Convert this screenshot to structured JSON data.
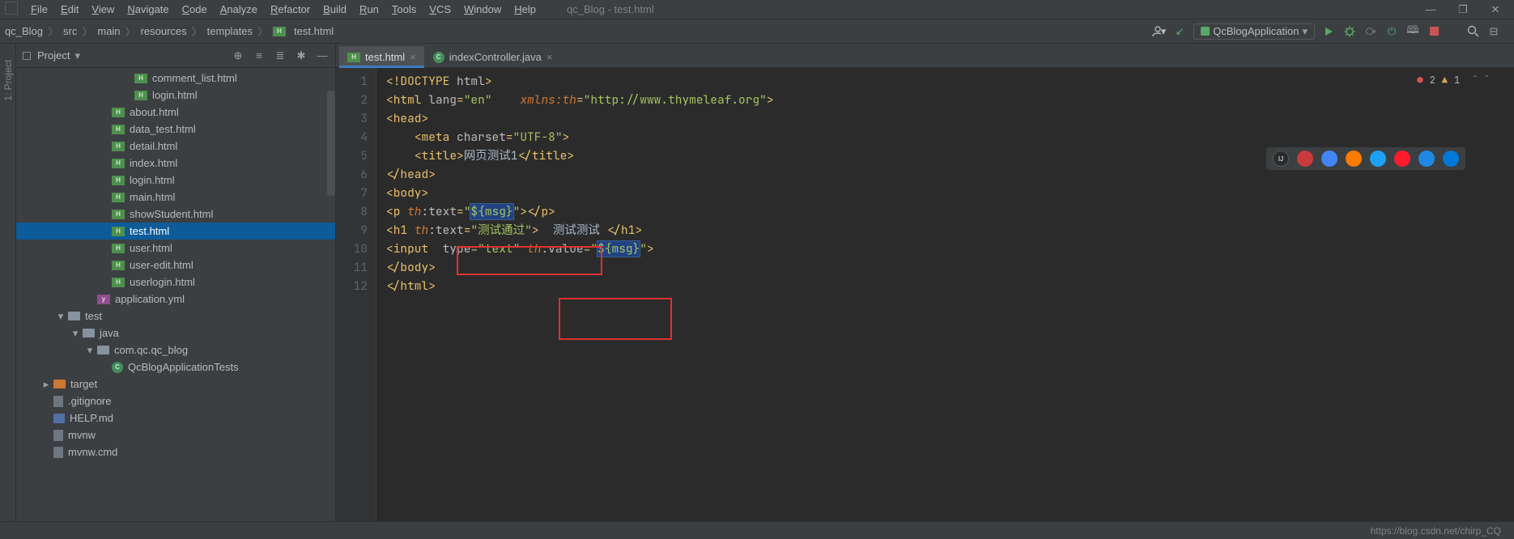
{
  "menus": [
    "File",
    "Edit",
    "View",
    "Navigate",
    "Code",
    "Analyze",
    "Refactor",
    "Build",
    "Run",
    "Tools",
    "VCS",
    "Window",
    "Help"
  ],
  "windowTitle": "qc_Blog - test.html",
  "breadcrumbs": [
    "qc_Blog",
    "src",
    "main",
    "resources",
    "templates",
    "test.html"
  ],
  "runConfig": "QcBlogApplication",
  "sidebar": {
    "title": "Project",
    "vertical": "1: Project",
    "items": [
      {
        "indent": 5,
        "icon": "html",
        "label": "comment_list.html"
      },
      {
        "indent": 5,
        "icon": "html",
        "label": "login.html"
      },
      {
        "indent": 4,
        "icon": "html",
        "label": "about.html"
      },
      {
        "indent": 4,
        "icon": "html",
        "label": "data_test.html"
      },
      {
        "indent": 4,
        "icon": "html",
        "label": "detail.html"
      },
      {
        "indent": 4,
        "icon": "html",
        "label": "index.html"
      },
      {
        "indent": 4,
        "icon": "html",
        "label": "login.html"
      },
      {
        "indent": 4,
        "icon": "html",
        "label": "main.html"
      },
      {
        "indent": 4,
        "icon": "html",
        "label": "showStudent.html"
      },
      {
        "indent": 4,
        "icon": "html",
        "label": "test.html",
        "selected": true
      },
      {
        "indent": 4,
        "icon": "html",
        "label": "user.html"
      },
      {
        "indent": 4,
        "icon": "html",
        "label": "user-edit.html"
      },
      {
        "indent": 4,
        "icon": "html",
        "label": "userlogin.html"
      },
      {
        "indent": 3,
        "icon": "yml",
        "label": "application.yml"
      },
      {
        "indent": 1,
        "icon": "folder",
        "label": "test",
        "tw": "▾"
      },
      {
        "indent": 2,
        "icon": "folder",
        "label": "java",
        "tw": "▾"
      },
      {
        "indent": 3,
        "icon": "folder",
        "label": "com.qc.qc_blog",
        "tw": "▾"
      },
      {
        "indent": 4,
        "icon": "class",
        "label": "QcBlogApplicationTests"
      },
      {
        "indent": 0,
        "icon": "folderred",
        "label": "target",
        "tw": "▸"
      },
      {
        "indent": 0,
        "icon": "file",
        "label": ".gitignore"
      },
      {
        "indent": 0,
        "icon": "md",
        "label": "HELP.md"
      },
      {
        "indent": 0,
        "icon": "file",
        "label": "mvnw"
      },
      {
        "indent": 0,
        "icon": "file",
        "label": "mvnw.cmd"
      }
    ]
  },
  "tabs": [
    {
      "icon": "html",
      "label": "test.html",
      "active": true
    },
    {
      "icon": "class",
      "label": "indexController.java",
      "active": false
    }
  ],
  "inspection": {
    "errors": "2",
    "warnings": "1"
  },
  "code": {
    "lines": [
      1,
      2,
      3,
      4,
      5,
      6,
      7,
      8,
      9,
      10,
      11,
      12
    ],
    "content": {
      "1": [
        [
          "sym",
          "<!"
        ],
        [
          "tag",
          "DOCTYPE "
        ],
        [
          "attr",
          "html"
        ],
        [
          "sym",
          ">"
        ]
      ],
      "2": [
        [
          "sym",
          "<"
        ],
        [
          "tag",
          "html "
        ],
        [
          "attr",
          "lang"
        ],
        [
          "sym",
          "="
        ],
        [
          "str",
          "\"en\""
        ],
        [
          "txt",
          "    "
        ],
        [
          "ns",
          "xmlns:th"
        ],
        [
          "sym",
          "="
        ],
        [
          "str",
          "\"http://www.thymeleaf.org\""
        ],
        [
          "sym",
          ">"
        ]
      ],
      "3": [
        [
          "sym",
          "<"
        ],
        [
          "tag",
          "head"
        ],
        [
          "sym",
          ">"
        ]
      ],
      "4": [
        [
          "txt",
          "    "
        ],
        [
          "sym",
          "<"
        ],
        [
          "tag",
          "meta "
        ],
        [
          "attr",
          "charset"
        ],
        [
          "sym",
          "="
        ],
        [
          "str",
          "\"UTF-8\""
        ],
        [
          "sym",
          ">"
        ]
      ],
      "5": [
        [
          "txt",
          "    "
        ],
        [
          "sym",
          "<"
        ],
        [
          "tag",
          "title"
        ],
        [
          "sym",
          ">"
        ],
        [
          "txt",
          "网页测试1"
        ],
        [
          "sym",
          "</"
        ],
        [
          "tag",
          "title"
        ],
        [
          "sym",
          ">"
        ]
      ],
      "6": [
        [
          "sym",
          "</"
        ],
        [
          "tag",
          "head"
        ],
        [
          "sym",
          ">"
        ]
      ],
      "7": [
        [
          "sym",
          "<"
        ],
        [
          "tag",
          "body"
        ],
        [
          "sym",
          ">"
        ]
      ],
      "8": [
        [
          "sym",
          "<"
        ],
        [
          "tag",
          "p "
        ],
        [
          "ns",
          "th"
        ],
        [
          "attr",
          ":text"
        ],
        [
          "sym",
          "="
        ],
        [
          "str",
          "\""
        ],
        [
          "hl",
          "${msg}"
        ],
        [
          "str",
          "\""
        ],
        [
          "sym",
          "></"
        ],
        [
          "tag",
          "p"
        ],
        [
          "sym",
          ">"
        ]
      ],
      "9": [
        [
          "sym",
          "<"
        ],
        [
          "tag",
          "h1 "
        ],
        [
          "ns",
          "th"
        ],
        [
          "attr",
          ":text"
        ],
        [
          "sym",
          "="
        ],
        [
          "str",
          "\"测试通过\""
        ],
        [
          "sym",
          ">"
        ],
        [
          "txt",
          "  测试测试 "
        ],
        [
          "sym",
          "</"
        ],
        [
          "tag",
          "h1"
        ],
        [
          "sym",
          ">"
        ]
      ],
      "10": [
        [
          "sym",
          "<"
        ],
        [
          "tag",
          "input "
        ],
        [
          "txt",
          " "
        ],
        [
          "attr",
          "type"
        ],
        [
          "sym",
          "="
        ],
        [
          "str",
          "\"text\""
        ],
        [
          "txt",
          " "
        ],
        [
          "ns",
          "th"
        ],
        [
          "attr",
          ":value"
        ],
        [
          "sym",
          "="
        ],
        [
          "str",
          "\""
        ],
        [
          "hl",
          "${msg}"
        ],
        [
          "str",
          "\""
        ],
        [
          "sym",
          ">"
        ]
      ],
      "11": [
        [
          "sym",
          "</"
        ],
        [
          "tag",
          "body"
        ],
        [
          "sym",
          ">"
        ]
      ],
      "12": [
        [
          "sym",
          "</"
        ],
        [
          "tag",
          "html"
        ],
        [
          "sym",
          ">"
        ]
      ]
    }
  },
  "statusText": "https://blog.csdn.net/chirp_CQ",
  "floatColors": [
    "#c93a3d",
    "#4285f4",
    "#ff7a00",
    "#1da1f2",
    "#ff1b2d",
    "#1e88e5",
    "#0078d7"
  ]
}
